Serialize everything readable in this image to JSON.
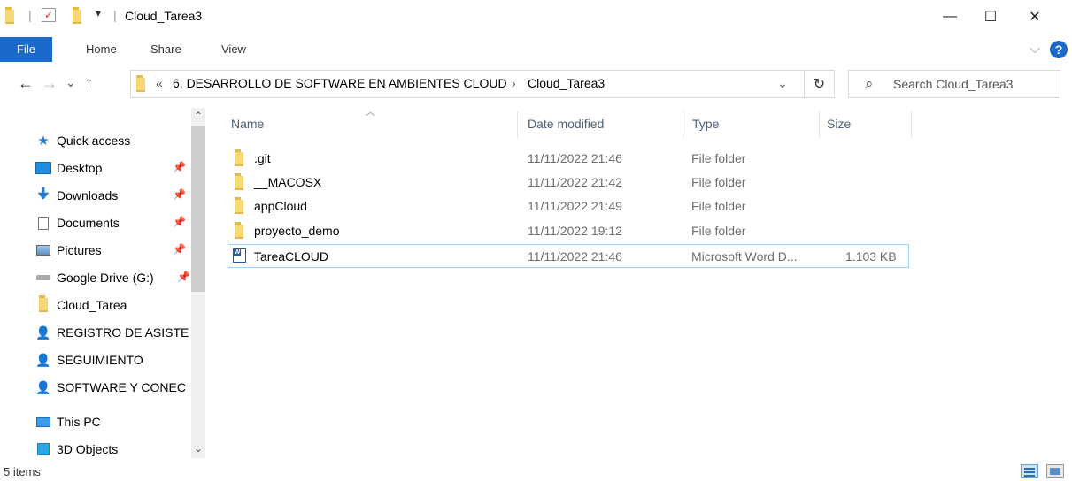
{
  "window": {
    "title": "Cloud_Tarea3",
    "minimize": "—",
    "maximize": "☐",
    "close": "✕"
  },
  "ribbon": {
    "tabs": [
      "File",
      "Home",
      "Share",
      "View"
    ],
    "collapse": "⌵",
    "help": "?"
  },
  "address": {
    "back": "←",
    "forward": "→",
    "recent": "⌄",
    "up": "↑",
    "overflow": "«",
    "crumbs": [
      "6. DESARROLLO DE SOFTWARE EN AMBIENTES CLOUD",
      "Cloud_Tarea3"
    ],
    "separator": "›",
    "dropdown": "⌄",
    "refresh": "↻"
  },
  "search": {
    "placeholder": "Search Cloud_Tarea3",
    "icon": "⌕"
  },
  "nav": {
    "items": [
      {
        "label": "Quick access",
        "icon": "star-icon",
        "pinned": false
      },
      {
        "label": "Desktop",
        "icon": "desktop-icon",
        "pinned": true
      },
      {
        "label": "Downloads",
        "icon": "download-icon",
        "pinned": true
      },
      {
        "label": "Documents",
        "icon": "documents-icon",
        "pinned": true
      },
      {
        "label": "Pictures",
        "icon": "pictures-icon",
        "pinned": true
      },
      {
        "label": "Google Drive (G:)",
        "icon": "drive-icon",
        "pinned": true
      },
      {
        "label": "Cloud_Tarea",
        "icon": "folder-icon",
        "pinned": false
      },
      {
        "label": "REGISTRO DE ASISTE",
        "icon": "shared-user-icon",
        "pinned": false
      },
      {
        "label": "SEGUIMIENTO",
        "icon": "shared-user-icon",
        "pinned": false
      },
      {
        "label": "SOFTWARE Y CONEC",
        "icon": "shared-user-icon",
        "pinned": false
      },
      {
        "label": "This PC",
        "icon": "computer-icon",
        "pinned": false
      },
      {
        "label": "3D Objects",
        "icon": "cube-icon",
        "pinned": false
      }
    ],
    "pin_glyph": "📌",
    "scroll_up": "⌃",
    "scroll_down": "⌄"
  },
  "files": {
    "columns": {
      "name": "Name",
      "date": "Date modified",
      "type": "Type",
      "size": "Size"
    },
    "sort_indicator": "︿",
    "rows": [
      {
        "name": ".git",
        "date": "11/11/2022 21:46",
        "type": "File folder",
        "size": "",
        "icon": "folder-icon"
      },
      {
        "name": "__MACOSX",
        "date": "11/11/2022 21:42",
        "type": "File folder",
        "size": "",
        "icon": "folder-icon"
      },
      {
        "name": "appCloud",
        "date": "11/11/2022 21:49",
        "type": "File folder",
        "size": "",
        "icon": "folder-icon"
      },
      {
        "name": "proyecto_demo",
        "date": "11/11/2022 19:12",
        "type": "File folder",
        "size": "",
        "icon": "folder-icon"
      },
      {
        "name": "TareaCLOUD",
        "date": "11/11/2022 21:46",
        "type": "Microsoft Word D...",
        "size": "1.103 KB",
        "icon": "word-doc-icon"
      }
    ]
  },
  "status": {
    "count": "5 items"
  },
  "colors": {
    "accent": "#1b6ac9",
    "folder": "#f8d775",
    "selection_border": "#99d1ff",
    "header_text": "#4c607a"
  }
}
